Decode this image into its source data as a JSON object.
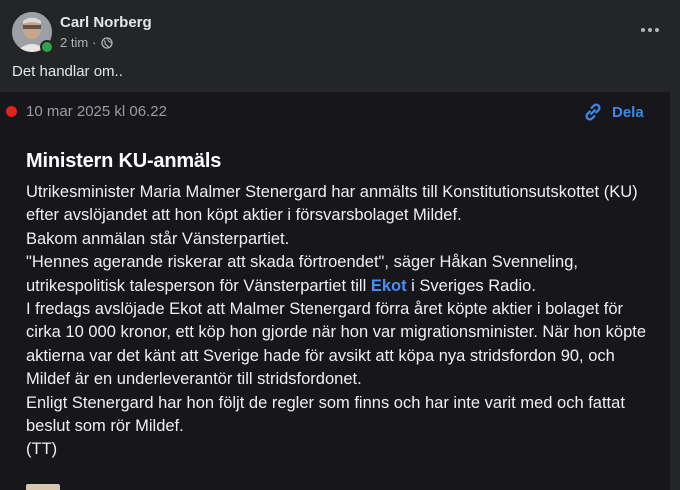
{
  "post": {
    "author": "Carl Norberg",
    "time": "2 tim",
    "separator": "·",
    "text": "Det handlar om.."
  },
  "embed": {
    "timestamp": "10 mar 2025 kl 06.22",
    "share_label": "Dela",
    "headline": "Ministern KU-anmäls",
    "paragraphs": {
      "p1": "Utrikesminister Maria Malmer Stenergard har anmälts till Konstitutionsutskottet (KU) efter avslöjandet att hon köpt aktier i försvarsbolaget Mildef.",
      "p2": "Bakom anmälan står Vänsterpartiet.",
      "p3_before": "\"Hennes agerande riskerar att skada förtroendet\", säger Håkan Svenneling, utrikespolitisk talesperson för Vänsterpartiet till ",
      "p3_link": "Ekot",
      "p3_after": " i Sveriges Radio.",
      "p4": "I fredags avslöjade Ekot att Malmer Stenergard förra året köpte aktier i bolaget för cirka 10 000 kronor, ett köp hon gjorde när hon var migrationsminister. När hon köpte aktierna var det känt att Sverige hade för avsikt att köpa nya stridsfordon 90, och Mildef är en underleverantör till stridsfordonet.",
      "p5": "Enligt Stenergard har hon följt de regler som finns och har inte varit med och fattat beslut som rör Mildef.",
      "p6": "(TT)"
    }
  },
  "colors": {
    "background": "#242526",
    "embed_background": "#16161b",
    "link": "#4a8ef0",
    "live_dot": "#e0241f",
    "online": "#31a24c"
  },
  "icons": {
    "audience": "globe-icon",
    "share": "link-icon",
    "menu": "more-icon"
  }
}
